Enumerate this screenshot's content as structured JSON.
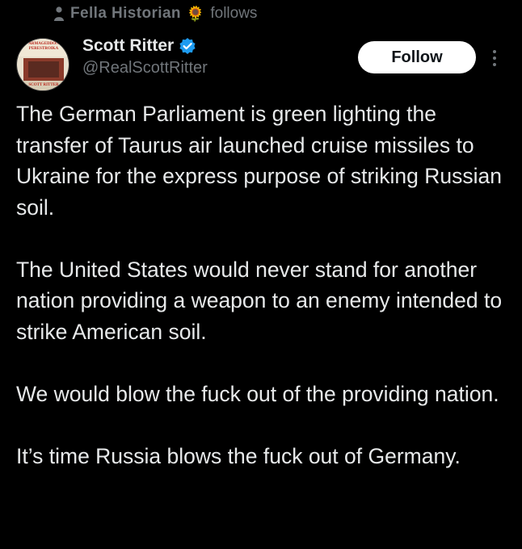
{
  "social_context": {
    "icon": "person-icon",
    "name": "Fella Historian",
    "emoji": "🌻",
    "suffix": "follows"
  },
  "author": {
    "display_name": "Scott Ritter",
    "handle": "@RealScottRitter",
    "verified_color": "#1d9bf0",
    "avatar_text_top": "ARMAGEDDON PERESTROIKA",
    "avatar_text_bottom": "SCOTT RITTER"
  },
  "actions": {
    "follow_label": "Follow",
    "more_icon": "more-vertical-icon"
  },
  "tweet": {
    "paragraphs": [
      "The German Parliament is green lighting the transfer of Taurus air launched cruise missiles to Ukraine for the express purpose of striking Russian soil.",
      "The United States would never stand for another nation providing a weapon to an enemy intended to strike American soil.",
      "We would blow the fuck out of the providing nation.",
      "It’s time Russia blows the fuck out of Germany."
    ]
  },
  "colors": {
    "background": "#000000",
    "text": "#e7e9ea",
    "secondary": "#71767b",
    "button_bg": "#ffffff",
    "accent": "#1d9bf0"
  }
}
